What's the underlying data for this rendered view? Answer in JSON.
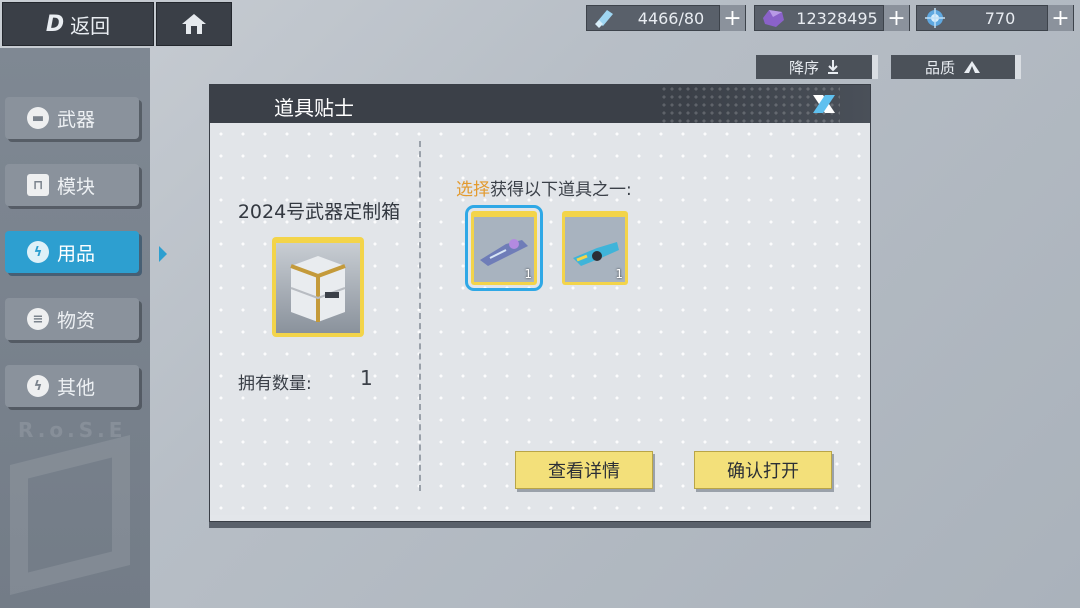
{
  "topbar": {
    "back_label": "返回",
    "back_logo": "D",
    "resources": [
      {
        "icon": "energy-icon",
        "value": "4466/80"
      },
      {
        "icon": "crystal-icon",
        "value": "12328495"
      },
      {
        "icon": "orb-icon",
        "value": "770"
      }
    ],
    "sort_desc": "降序",
    "sort_quality": "品质"
  },
  "tabs": [
    {
      "label": "武器",
      "icon": "weapon-icon",
      "active": false
    },
    {
      "label": "模块",
      "icon": "lock-icon",
      "active": false
    },
    {
      "label": "用品",
      "icon": "lightning-icon",
      "active": true
    },
    {
      "label": "物资",
      "icon": "supply-icon",
      "active": false
    },
    {
      "label": "其他",
      "icon": "lightning-icon",
      "active": false
    }
  ],
  "bg_text": "R.o.S.E",
  "modal": {
    "title": "道具贴士",
    "box_name": "2024号武器定制箱",
    "owned_label": "拥有数量:",
    "owned_value": "1",
    "choose_highlight": "选择",
    "choose_rest": "获得以下道具之一:",
    "items": [
      {
        "name": "energy-rifle-item",
        "count": "1",
        "selected": true
      },
      {
        "name": "blaster-gun-item",
        "count": "1",
        "selected": false
      }
    ],
    "btn_details": "查看详情",
    "btn_open": "确认打开"
  },
  "colors": {
    "accent_blue": "#2d9fd0",
    "card_gold": "#f3d44a",
    "highlight_orange": "#e39a2e",
    "button_yellow": "#f3e07a"
  }
}
